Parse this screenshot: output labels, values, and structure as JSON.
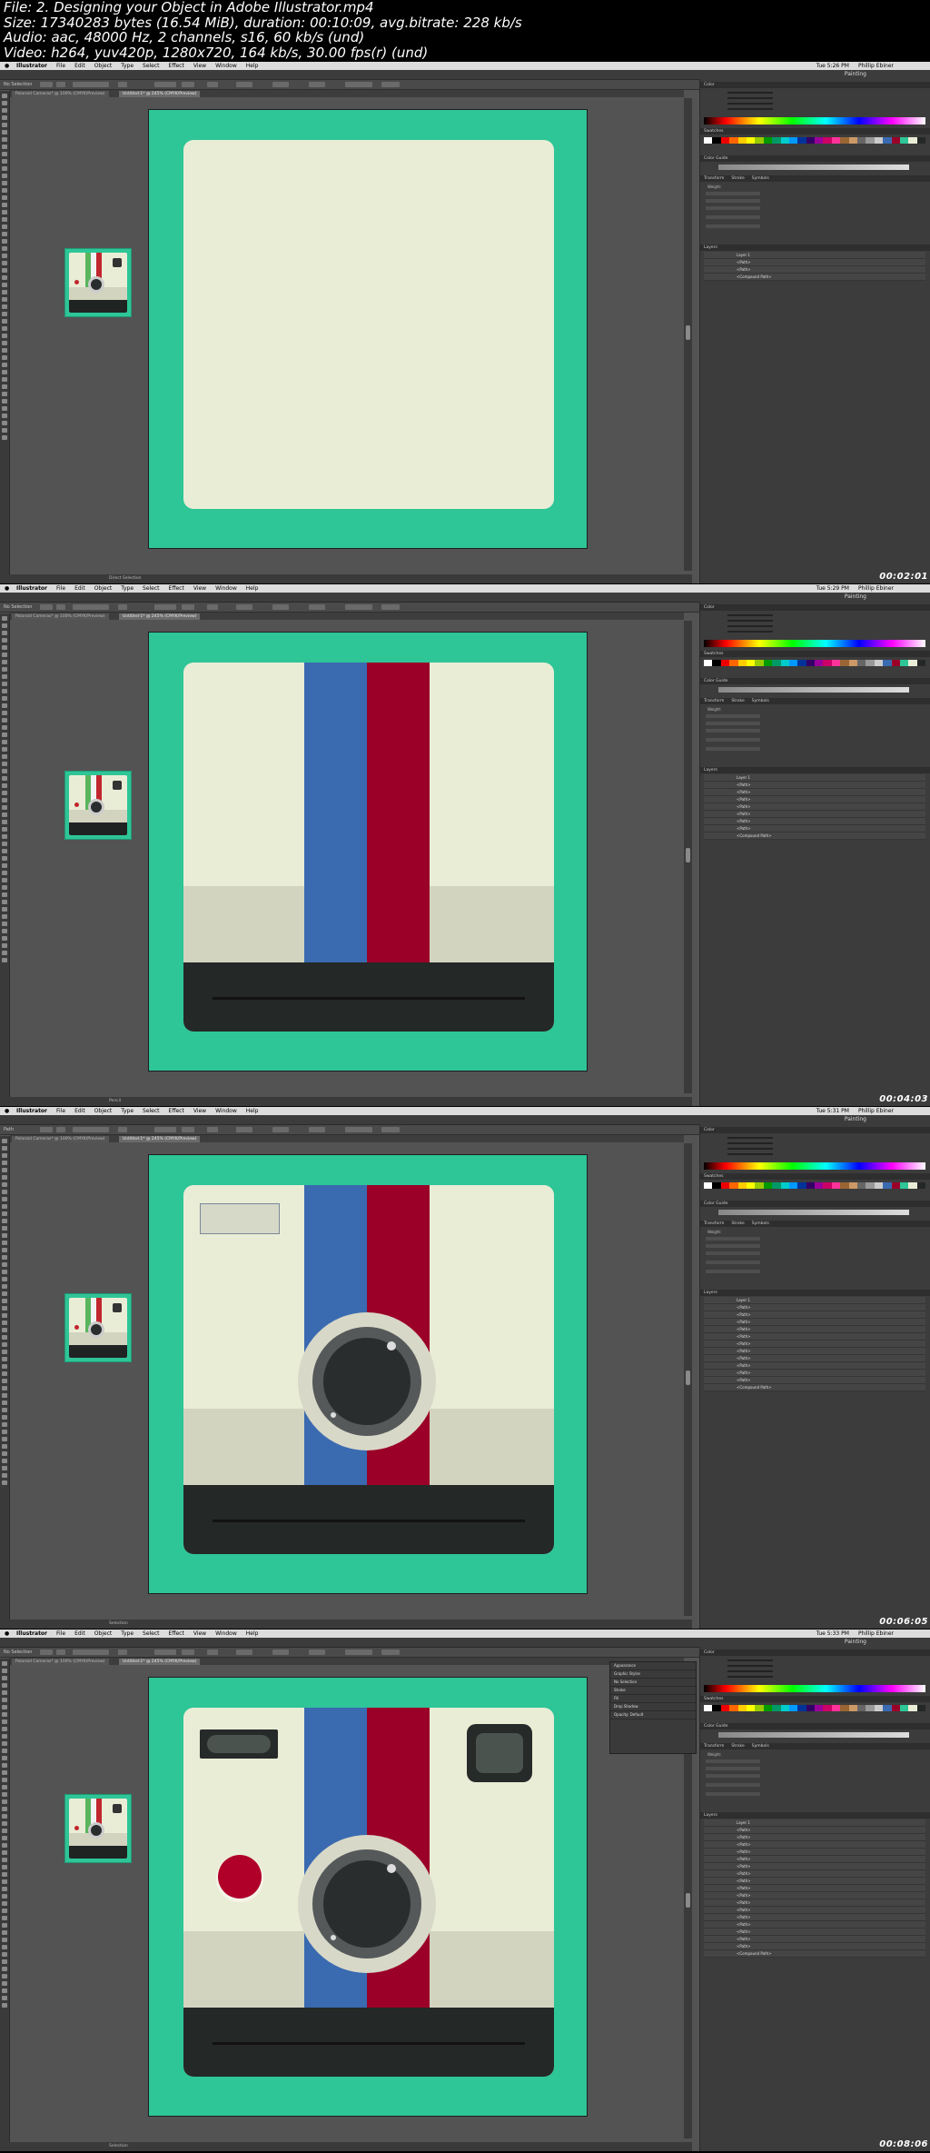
{
  "video_info": {
    "line1": "File: 2. Designing your Object in Adobe Illustrator.mp4",
    "line2": "Size: 17340283 bytes (16.54 MiB), duration: 00:10:09, avg.bitrate: 228 kb/s",
    "line3": "Audio: aac, 48000 Hz, 2 channels, s16, 60 kb/s (und)",
    "line4": "Video: h264, yuv420p, 1280x720, 164 kb/s, 30.00 fps(r) (und)"
  },
  "menubar": {
    "app_name": "Illustrator",
    "items": [
      "File",
      "Edit",
      "Object",
      "Type",
      "Select",
      "Effect",
      "View",
      "Window",
      "Help"
    ]
  },
  "colors": {
    "app_bg": "#535353",
    "artboard_bg": "#2ec597",
    "face": "#eaedd6",
    "blue_stripe": "#3a6ab0",
    "red_stripe": "#9b0029",
    "lower_band": "#d3d4c0",
    "bottom_band": "#242826",
    "lens_ring": "#d8d8c8",
    "lens_mid": "#55595a",
    "lens_inner": "#2a2d2d",
    "button_red": "#b0002a"
  },
  "frames": [
    {
      "clock": "Tue 5:26 PM",
      "user": "Phillip Ebiner",
      "workspace": "Painting",
      "doc_tab": "Untitled-1* @ 245% (CMYK/Preview)",
      "inactive_tab": "Polaroid Cameras* @ 100% (CMYK/Preview)",
      "selection_label": "No Selection",
      "status_text": "Direct Selection",
      "timecode": "00:02:01",
      "layers": [
        "Layer 1",
        "<Path>",
        "<Path>",
        "<Compound Path>"
      ]
    },
    {
      "clock": "Tue 5:29 PM",
      "user": "Phillip Ebiner",
      "workspace": "Painting",
      "doc_tab": "Untitled-1* @ 245% (CMYK/Preview)",
      "inactive_tab": "Polaroid Cameras* @ 100% (CMYK/Preview)",
      "selection_label": "No Selection",
      "status_text": "Pencil",
      "timecode": "00:04:03",
      "layers": [
        "Layer 1",
        "<Path>",
        "<Path>",
        "<Path>",
        "<Path>",
        "<Path>",
        "<Path>",
        "<Path>",
        "<Compound Path>"
      ]
    },
    {
      "clock": "Tue 5:31 PM",
      "user": "Phillip Ebiner",
      "workspace": "Painting",
      "doc_tab": "Untitled-1* @ 245% (CMYK/Preview)",
      "inactive_tab": "Polaroid Cameras* @ 100% (CMYK/Preview)",
      "selection_label": "Path",
      "status_text": "Selection",
      "timecode": "00:06:05",
      "layers": [
        "Layer 1",
        "<Path>",
        "<Path>",
        "<Path>",
        "<Path>",
        "<Path>",
        "<Path>",
        "<Path>",
        "<Path>",
        "<Path>",
        "<Path>",
        "<Path>",
        "<Compound Path>"
      ]
    },
    {
      "clock": "Tue 5:33 PM",
      "user": "Phillip Ebiner",
      "workspace": "Painting",
      "doc_tab": "Untitled-1* @ 245% (CMYK/Preview)",
      "inactive_tab": "Polaroid Cameras* @ 100% (CMYK/Preview)",
      "selection_label": "No Selection",
      "status_text": "Selection",
      "timecode": "00:08:06",
      "appearance_panel": [
        "Appearance",
        "Graphic Styles",
        "No Selection",
        "Stroke",
        "Fill",
        "Drop Shadow",
        "Opacity: Default"
      ],
      "layers": [
        "Layer 1",
        "<Path>",
        "<Path>",
        "<Path>",
        "<Path>",
        "<Path>",
        "<Path>",
        "<Path>",
        "<Path>",
        "<Path>",
        "<Path>",
        "<Path>",
        "<Path>",
        "<Path>",
        "<Path>",
        "<Path>",
        "<Path>",
        "<Path>",
        "<Compound Path>"
      ]
    }
  ],
  "panel_labels": {
    "color": "Color",
    "swatches": "Swatches",
    "color_guide": "Color Guide",
    "stroke_tabs": [
      "Transform",
      "Stroke",
      "Symbols"
    ],
    "stroke": "Stroke",
    "weight": "Weight:",
    "layers": "Layers"
  }
}
